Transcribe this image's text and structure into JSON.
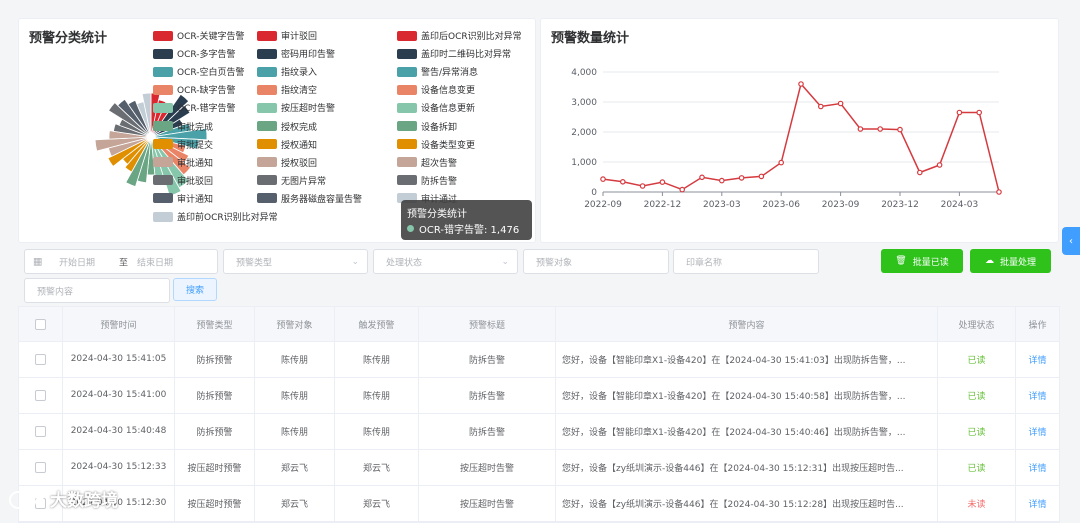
{
  "pie_card": {
    "title": "预警分类统计",
    "legend": [
      {
        "label": "OCR-关键字告警",
        "color": "#d9282f"
      },
      {
        "label": "审计驳回",
        "color": "#d9282f"
      },
      {
        "label": "盖印后OCR识别比对异常",
        "color": "#d9282f"
      },
      {
        "label": "OCR-多字告警",
        "color": "#2b3e50"
      },
      {
        "label": "密码用印告警",
        "color": "#2b3e50"
      },
      {
        "label": "盖印时二维码比对异常",
        "color": "#2b3e50"
      },
      {
        "label": "OCR-空白页告警",
        "color": "#4aa2a8"
      },
      {
        "label": "指纹录入",
        "color": "#4aa2a8"
      },
      {
        "label": "警告/异常消息",
        "color": "#4aa2a8"
      },
      {
        "label": "OCR-缺字告警",
        "color": "#e98466"
      },
      {
        "label": "指纹清空",
        "color": "#e98466"
      },
      {
        "label": "设备信息变更",
        "color": "#e98466"
      },
      {
        "label": "OCR-错字告警",
        "color": "#86c6aa"
      },
      {
        "label": "按压超时告警",
        "color": "#86c6aa"
      },
      {
        "label": "设备信息更新",
        "color": "#86c6aa"
      },
      {
        "label": "审批完成",
        "color": "#6aa584"
      },
      {
        "label": "授权完成",
        "color": "#6aa584"
      },
      {
        "label": "设备拆卸",
        "color": "#6aa584"
      },
      {
        "label": "审批提交",
        "color": "#e08f00"
      },
      {
        "label": "授权通知",
        "color": "#e08f00"
      },
      {
        "label": "设备类型变更",
        "color": "#e08f00"
      },
      {
        "label": "审批通知",
        "color": "#c4a598"
      },
      {
        "label": "授权驳回",
        "color": "#c4a598"
      },
      {
        "label": "超次告警",
        "color": "#c4a598"
      },
      {
        "label": "审批驳回",
        "color": "#6a6e72"
      },
      {
        "label": "无图片异常",
        "color": "#6a6e72"
      },
      {
        "label": "防拆告警",
        "color": "#6a6e72"
      },
      {
        "label": "审计通知",
        "color": "#56606c"
      },
      {
        "label": "服务器磁盘容量告警",
        "color": "#56606c"
      },
      {
        "label": "审计通过",
        "color": "#c3cdd6"
      },
      {
        "label": "盖印前OCR识别比对异常",
        "color": "#c3cdd6"
      }
    ],
    "tooltip": {
      "title": "预警分类统计",
      "item": "OCR-错字告警: 1,476"
    }
  },
  "line_card": {
    "title": "预警数量统计"
  },
  "chart_data": {
    "type": "line",
    "title": "预警数量统计",
    "x": [
      "2022-09",
      "2022-10",
      "2022-11",
      "2022-12",
      "2023-01",
      "2023-02",
      "2023-03",
      "2023-04",
      "2023-05",
      "2023-06",
      "2023-07",
      "2023-08",
      "2023-09",
      "2023-10",
      "2023-11",
      "2023-12",
      "2024-01",
      "2024-02",
      "2024-03",
      "2024-04",
      "2024-05"
    ],
    "values": [
      430,
      340,
      200,
      330,
      80,
      490,
      380,
      470,
      520,
      980,
      3600,
      2850,
      2950,
      2100,
      2100,
      2080,
      650,
      900,
      2650,
      2650,
      0
    ],
    "x_tick_labels": [
      "2022-09",
      "2022-12",
      "2023-03",
      "2023-06",
      "2023-09",
      "2023-12",
      "2024-03"
    ],
    "y_tick_labels": [
      "0",
      "1,000",
      "2,000",
      "3,000",
      "4,000"
    ],
    "ylim": [
      0,
      4000
    ],
    "grid": "horizontal",
    "color": "#d53a3f"
  },
  "filters": {
    "start_date": "开始日期",
    "date_sep": "至",
    "end_date": "结束日期",
    "alert_type": "预警类型",
    "process_status": "处理状态",
    "alert_target": "预警对象",
    "seal_name": "印章名称",
    "alert_content": "预警内容",
    "search": "搜索",
    "batch_read": "批量已读",
    "batch_process": "批量处理"
  },
  "table": {
    "headers": [
      "预警时间",
      "预警类型",
      "预警对象",
      "触发预警",
      "预警标题",
      "预警内容",
      "处理状态",
      "操作"
    ],
    "rows": [
      {
        "time": "2024-04-30 15:41:05",
        "type": "防拆预警",
        "target": "陈传朋",
        "trigger": "陈传朋",
        "title": "防拆告警",
        "content": "您好，设备【智能印章X1-设备420】在【2024-04-30 15:41:03】出现防拆告警，...",
        "status": "已读",
        "action": "详情"
      },
      {
        "time": "2024-04-30 15:41:00",
        "type": "防拆预警",
        "target": "陈传朋",
        "trigger": "陈传朋",
        "title": "防拆告警",
        "content": "您好，设备【智能印章X1-设备420】在【2024-04-30 15:40:58】出现防拆告警，...",
        "status": "已读",
        "action": "详情"
      },
      {
        "time": "2024-04-30 15:40:48",
        "type": "防拆预警",
        "target": "陈传朋",
        "trigger": "陈传朋",
        "title": "防拆告警",
        "content": "您好，设备【智能印章X1-设备420】在【2024-04-30 15:40:46】出现防拆告警，...",
        "status": "已读",
        "action": "详情"
      },
      {
        "time": "2024-04-30 15:12:33",
        "type": "按压超时预警",
        "target": "郑云飞",
        "trigger": "郑云飞",
        "title": "按压超时告警",
        "content": "您好，设备【zy纸圳演示-设备446】在【2024-04-30 15:12:31】出现按压超时告...",
        "status": "已读",
        "action": "详情"
      },
      {
        "time": "2024-04-30 15:12:30",
        "type": "按压超时预警",
        "target": "郑云飞",
        "trigger": "郑云飞",
        "title": "按压超时告警",
        "content": "您好，设备【zy纸圳演示-设备446】在【2024-04-30 15:12:28】出现按压超时告...",
        "status": "未读",
        "action": "详情"
      }
    ]
  },
  "side_tab": "‹",
  "watermark": "大数跨境"
}
